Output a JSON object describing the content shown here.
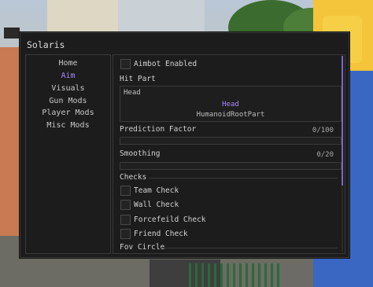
{
  "window": {
    "title": "Solaris"
  },
  "sidebar": {
    "items": [
      {
        "label": "Home"
      },
      {
        "label": "Aim"
      },
      {
        "label": "Visuals"
      },
      {
        "label": "Gun Mods"
      },
      {
        "label": "Player Mods"
      },
      {
        "label": "Misc Mods"
      }
    ],
    "active": "Aim"
  },
  "aim": {
    "aimbot_enabled": {
      "label": "Aimbot Enabled",
      "checked": false
    },
    "hit_part": {
      "label": "Hit Part",
      "selected": "Head",
      "options": [
        "Head",
        "HumanoidRootPart"
      ]
    },
    "prediction_factor": {
      "label": "Prediction Factor",
      "value_text": "0/100",
      "value": 0,
      "max": 100
    },
    "smoothing": {
      "label": "Smoothing",
      "value_text": "0/20",
      "value": 0,
      "max": 20
    },
    "checks": {
      "label": "Checks",
      "items": [
        {
          "label": "Team Check",
          "checked": false
        },
        {
          "label": "Wall Check",
          "checked": false
        },
        {
          "label": "Forcefeild Check",
          "checked": false
        },
        {
          "label": "Friend Check",
          "checked": false
        }
      ]
    },
    "fov_circle": {
      "label": "Fov Circle"
    }
  },
  "colors": {
    "accent": "#a78bfa",
    "panel": "#1c1c1c",
    "border": "#3a3a3a"
  }
}
